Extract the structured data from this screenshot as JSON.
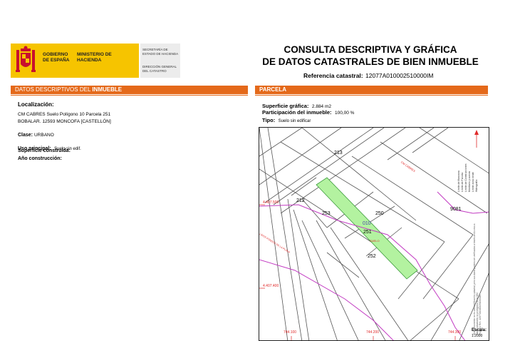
{
  "header": {
    "gobierno": "GOBIERNO DE ESPAÑA",
    "ministerio": "MINISTERIO DE HACIENDA",
    "secretaria": "SECRETARÍA DE ESTADO DE HACIENDA",
    "direccion": "DIRECCIÓN GENERAL DEL CATASTRO",
    "title_line1": "CONSULTA DESCRIPTIVA Y GRÁFICA",
    "title_line2": "DE DATOS CATASTRALES DE BIEN INMUEBLE",
    "ref_label": "Referencia catastral:",
    "ref_value": "12077A010002510000IM"
  },
  "left_section": {
    "title_prefix": "DATOS DESCRIPTIVOS DEL ",
    "title_bold": "INMUEBLE",
    "localizacion_label": "Localización:",
    "localizacion_line1": "CM CABRES  Suelo Polígono 10 Parcela 251",
    "localizacion_line2": "BOBALAR. 12593 MONCOFA [CASTELLÓN]",
    "clase_label": "Clase:",
    "clase_value": "URBANO",
    "uso_label": "Uso principal:",
    "uso_value": "Suelo sin edif.",
    "superficie_label": "Superficie construida:",
    "anio_label": "Año construcción:"
  },
  "right_section": {
    "title": "PARCELA",
    "superficie_label": "Superficie gráfica:",
    "superficie_value": "2.884 m2",
    "participacion_label": "Participación del inmueble:",
    "participacion_value": "100,00 %",
    "tipo_label": "Tipo:",
    "tipo_value": "Suelo sin edificar"
  },
  "map": {
    "parcels": [
      "213",
      "212",
      "253",
      "250",
      "010",
      "251",
      "252",
      "9081"
    ],
    "suelo": "SUELO",
    "road_label": "CM CABRES",
    "road_label2": "LLIDOS FONDOS DE LA PLANA",
    "coord_y1": "4.407.500",
    "coord_y2": "4.407.400",
    "coord_x1": "744.100",
    "coord_x2": "744.200",
    "coord_x3": "744.300",
    "escala_label": "Escala:",
    "escala_value": "1:2000",
    "legend": [
      "Límite de Manzana",
      "Límite de Parcela",
      "Límite de Construcciones",
      "Mobiliario y aceras",
      "Límite zona verde",
      "Hidrografía"
    ],
    "side_note": "Este documento no es una certificación catastral, pero sus datos pueden ser verificados a través del Acceso a datos catastrales no protegidos de la SEC",
    "side_note2": "Hoja 1/1   Ref.: 12077A010002510000IM"
  },
  "colors": {
    "accent": "#e4691a",
    "logo_yellow": "#f6c400",
    "parcel_fill": "#b3f2a0",
    "boundary_pink": "#c23bc2",
    "coord_red": "#e02a2a"
  }
}
